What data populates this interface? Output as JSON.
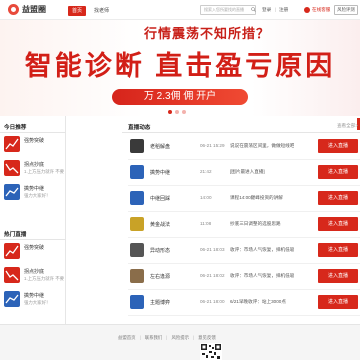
{
  "header": {
    "logo_text": "益盟圈",
    "nav": [
      {
        "label": "首页",
        "active": true
      },
      {
        "label": "找老师",
        "active": false
      }
    ],
    "search_placeholder": "搜索入您所要找的直播",
    "login": "登录",
    "register": "注册",
    "online_service": "在线客服",
    "risk_test": "风险评测"
  },
  "banner": {
    "line1": "行情震荡不知所措？",
    "line2": "智能诊断  直击盈亏原因",
    "pill": "万 2.3佣 佣 开户",
    "active_slide": 1,
    "slide_count": 3
  },
  "today": {
    "title": "今日推荐",
    "items": [
      {
        "name": "强势突破",
        "desc": "",
        "thumb": "red"
      },
      {
        "name": "拐点抄底",
        "desc": "1.上方压力就许 不要追...",
        "thumb": "red"
      },
      {
        "name": "擒势中继",
        "desc": "强力大家好！",
        "thumb": "blue"
      }
    ]
  },
  "hot": {
    "title": "热门直播",
    "items": [
      {
        "name": "强势突破",
        "desc": "",
        "thumb": "red"
      },
      {
        "name": "拐点抄底",
        "desc": "1.上方压力就许 不要追...",
        "thumb": "red"
      },
      {
        "name": "擒势中继",
        "desc": "强力大家好！",
        "thumb": "blue"
      }
    ]
  },
  "live": {
    "title": "直播动态",
    "view_all": "查看全部>",
    "button_label": "进入直播",
    "rows": [
      {
        "name": "老稻解盘",
        "time": "06-21 15:29",
        "desc": "说说在震荡区间里，做做短线吧"
      },
      {
        "name": "擒势中继",
        "time": "21:42",
        "desc": "[图片最进入直播]"
      },
      {
        "name": "中继回踩",
        "time": "14:00",
        "desc": "课程14:00巅峰投资的讲解"
      },
      {
        "name": "黄金战法",
        "time": "11:08",
        "desc": "抄底三日调整的选股思路"
      },
      {
        "name": "异动形态",
        "time": "06-21 18:03",
        "desc": "收评：市场人气恢复，择机低吸"
      },
      {
        "name": "左右逢源",
        "time": "06-21 18:02",
        "desc": "收评：市场人气恢复，择机低吸"
      },
      {
        "name": "主题博弈",
        "time": "06-21 18:00",
        "desc": "6/21早晚收评：站上3000点"
      }
    ]
  },
  "footer": {
    "links": [
      "益盟首页",
      "联系我们",
      "风险提示",
      "意见反馈"
    ]
  },
  "colors": {
    "brand": "#d7281b",
    "thumb_red": "#d7281b",
    "thumb_blue": "#2c63b8"
  }
}
